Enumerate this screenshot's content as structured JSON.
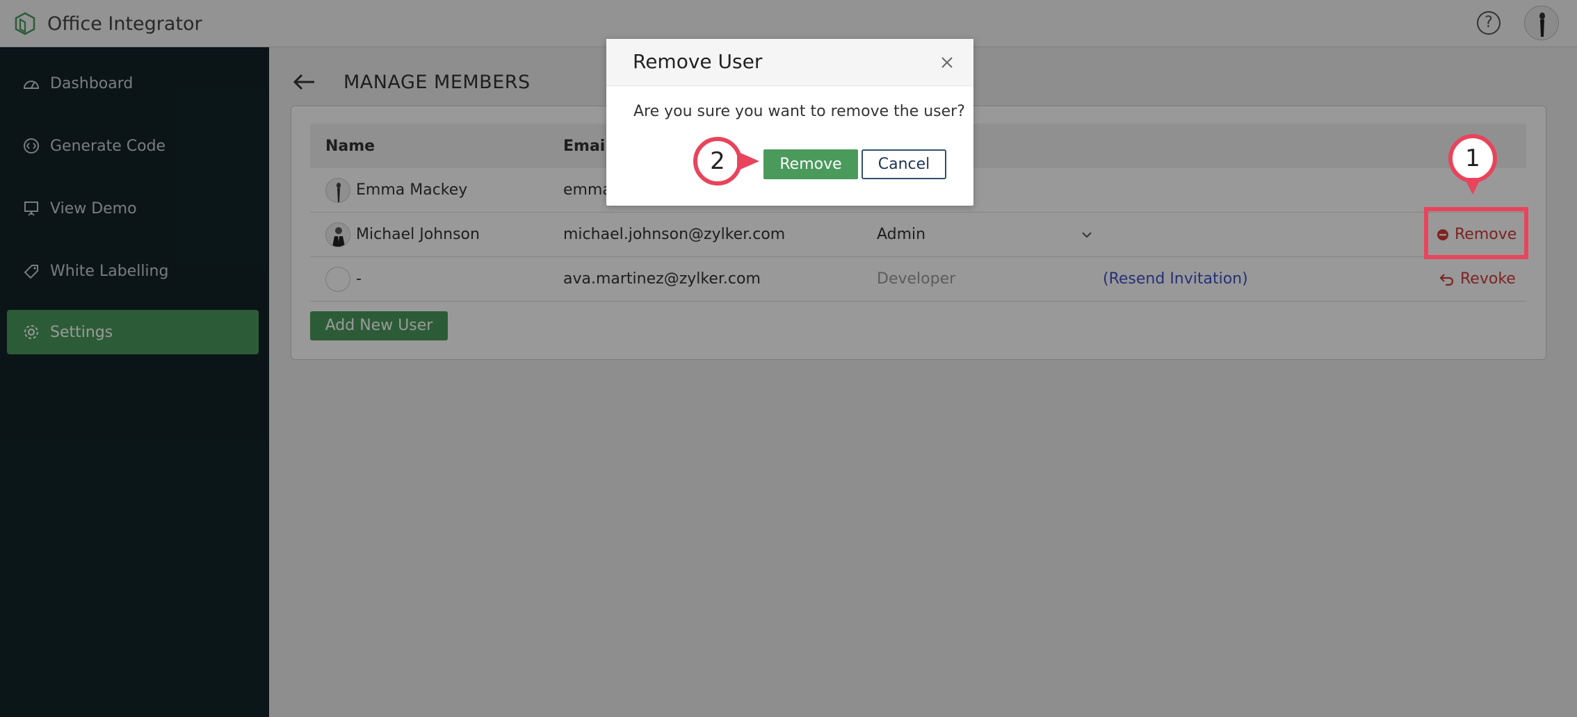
{
  "app": {
    "name": "Office Integrator",
    "help_glyph": "?"
  },
  "sidebar": {
    "items": [
      {
        "label": "Dashboard",
        "icon": "dashboard-icon"
      },
      {
        "label": "Generate Code",
        "icon": "code-icon"
      },
      {
        "label": "View Demo",
        "icon": "presentation-icon"
      },
      {
        "label": "White Labelling",
        "icon": "tag-icon"
      },
      {
        "label": "Settings",
        "icon": "gear-icon",
        "active": true
      }
    ]
  },
  "page": {
    "title": "MANAGE MEMBERS"
  },
  "table": {
    "columns": {
      "name": "Name",
      "email": "Email"
    },
    "rows": [
      {
        "name": "Emma Mackey",
        "email": "emma",
        "role": "",
        "status": "",
        "action": ""
      },
      {
        "name": "Michael Johnson",
        "email": "michael.johnson@zylker.com",
        "role": "Admin",
        "status": "",
        "action": "Remove"
      },
      {
        "name": "-",
        "email": "ava.martinez@zylker.com",
        "role": "Developer",
        "status": "(Resend Invitation)",
        "action": "Revoke"
      }
    ]
  },
  "add_user_label": "Add New User",
  "modal": {
    "title": "Remove User",
    "message": "Are you sure you want to remove the user?",
    "confirm_label": "Remove",
    "cancel_label": "Cancel"
  },
  "annotations": {
    "step1": "1",
    "step2": "2"
  },
  "colors": {
    "sidebar": "#132428",
    "accent": "#4a9a5c",
    "danger": "#d33a3a",
    "highlight": "#e8445b",
    "link": "#3f51c8"
  }
}
